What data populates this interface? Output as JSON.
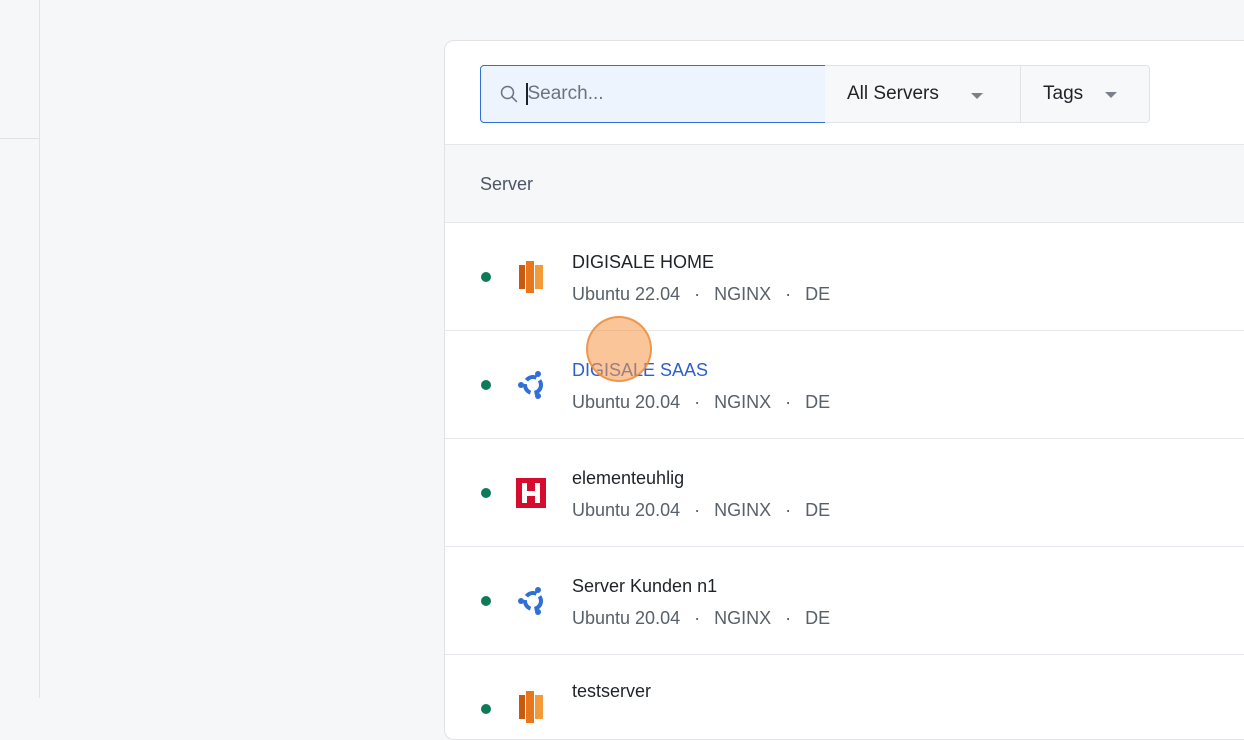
{
  "search": {
    "placeholder": "Search..."
  },
  "filters": {
    "servers_label": "All Servers",
    "tags_label": "Tags"
  },
  "table": {
    "column_header": "Server"
  },
  "servers": [
    {
      "name": "DIGISALE HOME",
      "os": "Ubuntu 22.04",
      "web": "NGINX",
      "region": "DE",
      "provider_icon": "aws-icon",
      "status": "online"
    },
    {
      "name": "DIGISALE SAAS",
      "os": "Ubuntu 20.04",
      "web": "NGINX",
      "region": "DE",
      "provider_icon": "ubuntu-icon",
      "status": "online"
    },
    {
      "name": "elementeuhlig",
      "os": "Ubuntu 20.04",
      "web": "NGINX",
      "region": "DE",
      "provider_icon": "hetzner-icon",
      "status": "online"
    },
    {
      "name": "Server Kunden n1",
      "os": "Ubuntu 20.04",
      "web": "NGINX",
      "region": "DE",
      "provider_icon": "ubuntu-icon",
      "status": "online"
    },
    {
      "name": "testserver",
      "provider_icon": "aws-icon",
      "status": "online"
    }
  ],
  "meta_separator": "·",
  "colors": {
    "accent": "#2f6fd6",
    "status_online": "#0f7a5a",
    "link_active": "#2f5fc9"
  }
}
